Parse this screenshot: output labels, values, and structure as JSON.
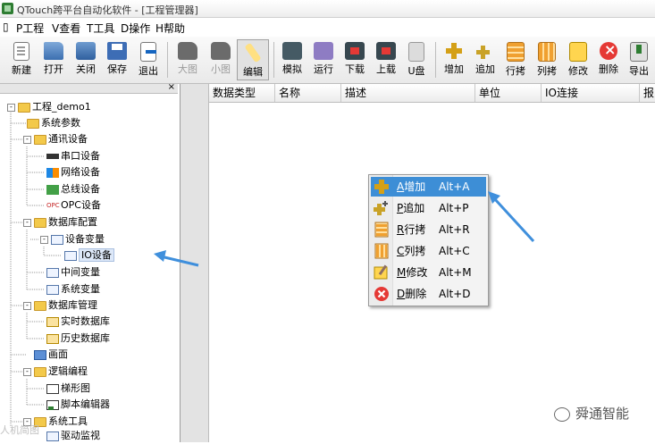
{
  "window": {
    "title": "QTouch跨平台自动化软件 - [工程管理器]"
  },
  "menu": [
    {
      "key": "P",
      "label": "P工程"
    },
    {
      "key": "V",
      "label": "V查看"
    },
    {
      "key": "T",
      "label": "T工具"
    },
    {
      "key": "D",
      "label": "D操作"
    },
    {
      "key": "H",
      "label": "H帮助"
    }
  ],
  "toolbar": {
    "new": "新建",
    "open": "打开",
    "close": "关闭",
    "save": "保存",
    "exit": "退出",
    "large": "大图",
    "small": "小图",
    "edit": "编辑",
    "simulate": "模拟",
    "run": "运行",
    "download": "下载",
    "upload": "上载",
    "udisk": "U盘",
    "add": "增加",
    "append": "追加",
    "row_copy": "行拷",
    "col_copy": "列拷",
    "modify": "修改",
    "delete": "删除",
    "export": "导出"
  },
  "tree": {
    "close_glyph": "×",
    "root": "工程_demo1",
    "system_params": "系统参数",
    "comm_devices": "通讯设备",
    "serial_device": "串口设备",
    "network_device": "网络设备",
    "bus_device": "总线设备",
    "opc_device": "OPC设备",
    "db_config": "数据库配置",
    "device_vars": "设备变量",
    "io_device": "IO设备",
    "middle_vars": "中间变量",
    "system_vars": "系统变量",
    "db_management": "数据库管理",
    "realtime_db": "实时数据库",
    "history_db": "历史数据库",
    "screen": "画面",
    "logic_programming": "逻辑编程",
    "ladder": "梯形图",
    "script_editor": "脚本编辑器",
    "system_tools": "系统工具",
    "driver_monitor": "驱动监视",
    "opc_icon_text": "OPC"
  },
  "grid": {
    "columns": [
      "数据类型",
      "名称",
      "描述",
      "单位",
      "IO连接",
      "报"
    ]
  },
  "context_menu": [
    {
      "accel": "A",
      "label": "增加",
      "shortcut": "Alt+A",
      "icon": "add-icon",
      "highlighted": true
    },
    {
      "accel": "P",
      "label": "追加",
      "shortcut": "Alt+P",
      "icon": "append-icon",
      "highlighted": false
    },
    {
      "accel": "R",
      "label": "行拷",
      "shortcut": "Alt+R",
      "icon": "row-copy-icon",
      "highlighted": false
    },
    {
      "accel": "C",
      "label": "列拷",
      "shortcut": "Alt+C",
      "icon": "col-copy-icon",
      "highlighted": false
    },
    {
      "accel": "M",
      "label": "修改",
      "shortcut": "Alt+M",
      "icon": "modify-icon",
      "highlighted": false
    },
    {
      "accel": "D",
      "label": "删除",
      "shortcut": "Alt+D",
      "icon": "delete-icon",
      "highlighted": false
    }
  ],
  "watermark": {
    "brand": "舜通智能",
    "source": "人机简图"
  },
  "colors": {
    "highlight": "#3d8ed6",
    "arrow": "#3f8fdc",
    "folder": "#f3c94a"
  }
}
